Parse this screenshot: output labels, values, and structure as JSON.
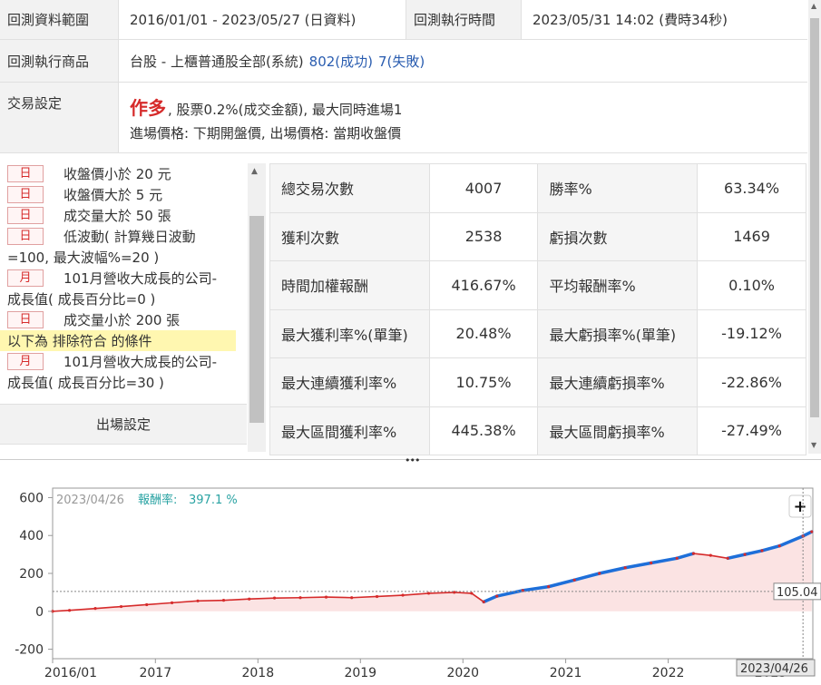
{
  "info": {
    "period_label": "回測資料範圍",
    "period_value": "2016/01/01 - 2023/05/27 (日資料)",
    "exec_time_label": "回測執行時間",
    "exec_time_value": "2023/05/31 14:02 (費時34秒)",
    "products_label": "回測執行商品",
    "products_value": "台股 - 上櫃普通股全部(系統)",
    "success_count": "802(成功)",
    "fail_count": "7(失敗)",
    "trade_label": "交易設定",
    "trade_direction": "作多",
    "trade_detail": ", 股票0.2%(成交金額), 最大同時進場1",
    "trade_prices": "進場價格: 下期開盤價, 出場價格: 當期收盤價"
  },
  "conditions": [
    {
      "badge": "日",
      "text": "收盤價小於 20 元"
    },
    {
      "badge": "日",
      "text": "收盤價大於 5 元"
    },
    {
      "badge": "日",
      "text": "成交量大於 50 張"
    },
    {
      "badge": "日",
      "text": "低波動( 計算幾日波動",
      "cont": "=100, 最大波幅%=20 )"
    },
    {
      "badge": "月",
      "text": "101月營收大成長的公司-",
      "cont": "成長值( 成長百分比=0 )"
    },
    {
      "badge": "日",
      "text": "成交量小於 200 張"
    },
    {
      "highlight": "以下為 排除符合 的條件"
    },
    {
      "badge": "月",
      "text": "101月營收大成長的公司-",
      "cont": "成長值( 成長百分比=30 )"
    }
  ],
  "exit_settings_label": "出場設定",
  "stats": [
    {
      "l1": "總交易次數",
      "v1": "4007",
      "l2": "勝率%",
      "v2": "63.34%",
      "c2": "#d62b2b"
    },
    {
      "l1": "獲利次數",
      "v1": "2538",
      "l2": "虧損次數",
      "v2": "1469"
    },
    {
      "l1": "時間加權報酬",
      "v1": "416.67%",
      "c1": "#d62b2b",
      "l2": "平均報酬率%",
      "v2": "0.10%"
    },
    {
      "l1": "最大獲利率%(單筆)",
      "v1": "20.48%",
      "l2": "最大虧損率%(單筆)",
      "v2": "-19.12%"
    },
    {
      "l1": "最大連續獲利率%",
      "v1": "10.75%",
      "l2": "最大連續虧損率%",
      "v2": "-22.86%"
    },
    {
      "l1": "最大區間獲利率%",
      "v1": "445.38%",
      "l2": "最大區間虧損率%",
      "v2": "-27.49%"
    }
  ],
  "chart": {
    "header_date": "2023/04/26",
    "header_label": "報酬率:",
    "header_value": "397.1 %",
    "plus_label": "+",
    "marker_value": "105.04",
    "cursor_date": "2023/04/26",
    "colors": {
      "line_red": "#d62b2b",
      "line_blue": "#1e6fd9",
      "fill": "#fbe3e3",
      "accent_teal": "#2aa3a3"
    }
  },
  "chart_data": {
    "type": "line",
    "title": "",
    "xlabel": "",
    "ylabel": "",
    "x_ticks": [
      "2016/01",
      "2017",
      "2018",
      "2019",
      "2020",
      "2021",
      "2022",
      "2023"
    ],
    "y_ticks": [
      600,
      400,
      200,
      0,
      -200
    ],
    "ylim": [
      -250,
      650
    ],
    "xlim": [
      "2016-01-01",
      "2023-05-31"
    ],
    "grid": false,
    "series": [
      {
        "x": [
          "2016-01-01",
          "2016-03-01",
          "2016-06-01",
          "2016-09-01",
          "2016-12-01",
          "2017-03-01",
          "2017-06-01",
          "2017-09-01",
          "2017-12-01",
          "2018-03-01",
          "2018-06-01",
          "2018-09-01",
          "2018-12-01",
          "2019-03-01",
          "2019-06-01",
          "2019-09-01",
          "2019-12-01",
          "2020-02-01",
          "2020-03-15",
          "2020-05-01",
          "2020-08-01",
          "2020-11-01",
          "2021-02-01",
          "2021-05-01",
          "2021-08-01",
          "2021-11-01",
          "2022-02-01",
          "2022-04-01",
          "2022-06-01",
          "2022-08-01",
          "2022-10-01",
          "2022-12-01",
          "2023-02-01",
          "2023-04-26",
          "2023-05-27"
        ],
        "y": [
          0,
          5,
          15,
          25,
          35,
          45,
          55,
          58,
          65,
          70,
          72,
          75,
          72,
          78,
          85,
          95,
          100,
          95,
          50,
          80,
          110,
          130,
          165,
          200,
          230,
          255,
          280,
          305,
          295,
          280,
          300,
          320,
          345,
          397,
          420
        ]
      }
    ]
  }
}
